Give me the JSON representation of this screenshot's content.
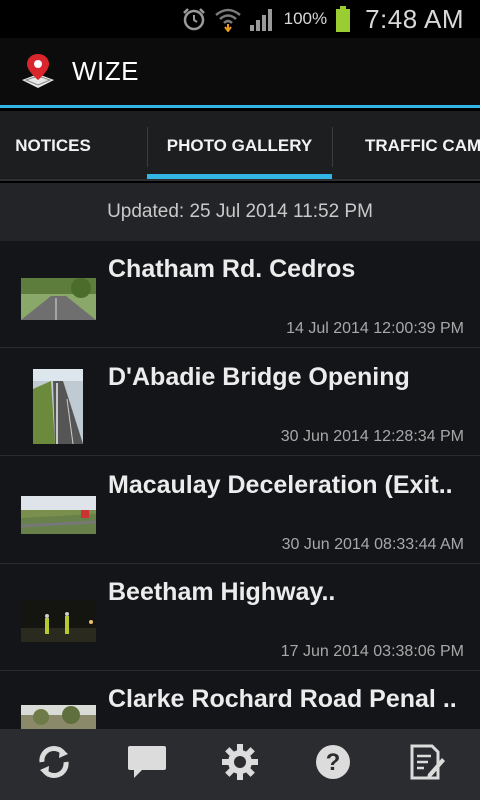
{
  "status_bar": {
    "battery_percent": "100%",
    "time": "7:48 AM",
    "icons": [
      "alarm-icon",
      "wifi-icon",
      "signal-icon",
      "battery-icon"
    ]
  },
  "app": {
    "title": "WIZE",
    "logo_icon": "map-pin-icon"
  },
  "tabs": [
    {
      "label": "NOTICES",
      "selected": false
    },
    {
      "label": "PHOTO GALLERY",
      "selected": true
    },
    {
      "label": "TRAFFIC CAMS",
      "selected": false
    }
  ],
  "updated_label": "Updated: 25 Jul 2014 11:52 PM",
  "gallery": [
    {
      "title": "Chatham Rd. Cedros",
      "date": "14 Jul 2014 12:00:39 PM"
    },
    {
      "title": "D'Abadie Bridge Opening",
      "date": "30 Jun 2014 12:28:34 PM"
    },
    {
      "title": "Macaulay Deceleration (Exit..",
      "date": "30 Jun 2014 08:33:44 AM"
    },
    {
      "title": "Beetham Highway..",
      "date": "17 Jun 2014 03:38:06 PM"
    },
    {
      "title": "Clarke Rochard Road Penal ..",
      "date": ""
    }
  ],
  "toolbar": [
    {
      "name": "refresh-icon"
    },
    {
      "name": "chat-icon"
    },
    {
      "name": "settings-icon"
    },
    {
      "name": "help-icon"
    },
    {
      "name": "edit-report-icon"
    }
  ],
  "colors": {
    "accent": "#33b5e5",
    "battery": "#9acd32"
  }
}
